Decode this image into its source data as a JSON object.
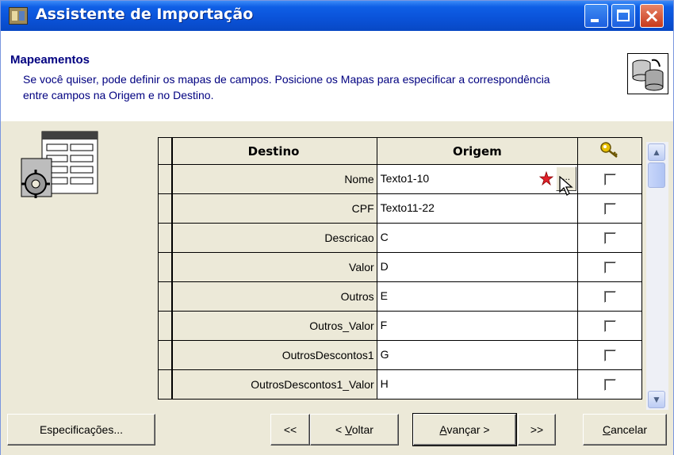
{
  "window": {
    "title": "Assistente de Importação",
    "controls": {
      "minimize": "minimize",
      "maximize": "maximize",
      "close": "×"
    }
  },
  "header": {
    "title": "Mapeamentos",
    "description": "Se você quiser, pode definir os mapas de campos. Posicione os Mapas para especificar a correspondência entre campos na Origem e no Destino."
  },
  "grid": {
    "columns": {
      "destino": "Destino",
      "origem": "Origem",
      "key_icon": "key-icon"
    },
    "rows": [
      {
        "destino": "Nome",
        "origem": "Texto1-10",
        "checked": false,
        "editing": true,
        "ellipsis": "..."
      },
      {
        "destino": "CPF",
        "origem": "Texto11-22",
        "checked": false
      },
      {
        "destino": "Descricao",
        "origem": "C",
        "checked": false
      },
      {
        "destino": "Valor",
        "origem": "D",
        "checked": false
      },
      {
        "destino": "Outros",
        "origem": "E",
        "checked": false
      },
      {
        "destino": "Outros_Valor",
        "origem": "F",
        "checked": false
      },
      {
        "destino": "OutrosDescontos1",
        "origem": "G",
        "checked": false
      },
      {
        "destino": "OutrosDescontos1_Valor",
        "origem": "H",
        "checked": false
      }
    ]
  },
  "footer": {
    "especificacoes": "Especificações...",
    "first": "<<",
    "voltar_pre": "< ",
    "voltar_u": "V",
    "voltar_post": "oltar",
    "avancar_u": "A",
    "avancar_post": "vançar >",
    "last": ">>",
    "cancelar_u": "C",
    "cancelar_post": "ancelar"
  },
  "colors": {
    "title_bar": "#0a52d8",
    "header_text": "#000080",
    "face": "#ece9d8"
  }
}
